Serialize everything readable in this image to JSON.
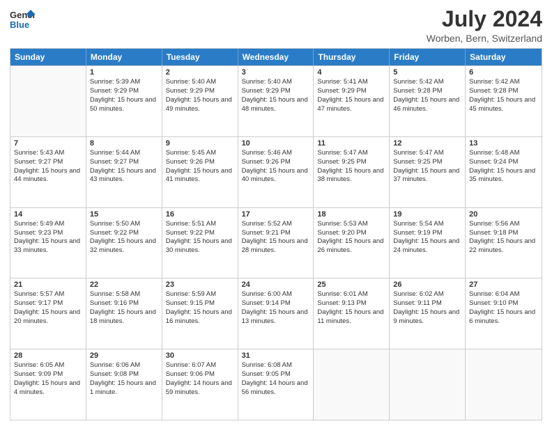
{
  "logo": {
    "text_general": "General",
    "text_blue": "Blue"
  },
  "title": "July 2024",
  "subtitle": "Worben, Bern, Switzerland",
  "days": [
    "Sunday",
    "Monday",
    "Tuesday",
    "Wednesday",
    "Thursday",
    "Friday",
    "Saturday"
  ],
  "weeks": [
    [
      {
        "day": "",
        "empty": true
      },
      {
        "day": "1",
        "rise": "5:39 AM",
        "set": "9:29 PM",
        "daylight": "15 hours and 50 minutes."
      },
      {
        "day": "2",
        "rise": "5:40 AM",
        "set": "9:29 PM",
        "daylight": "15 hours and 49 minutes."
      },
      {
        "day": "3",
        "rise": "5:40 AM",
        "set": "9:29 PM",
        "daylight": "15 hours and 48 minutes."
      },
      {
        "day": "4",
        "rise": "5:41 AM",
        "set": "9:29 PM",
        "daylight": "15 hours and 47 minutes."
      },
      {
        "day": "5",
        "rise": "5:42 AM",
        "set": "9:28 PM",
        "daylight": "15 hours and 46 minutes."
      },
      {
        "day": "6",
        "rise": "5:42 AM",
        "set": "9:28 PM",
        "daylight": "15 hours and 45 minutes."
      }
    ],
    [
      {
        "day": "7",
        "rise": "5:43 AM",
        "set": "9:27 PM",
        "daylight": "15 hours and 44 minutes."
      },
      {
        "day": "8",
        "rise": "5:44 AM",
        "set": "9:27 PM",
        "daylight": "15 hours and 43 minutes."
      },
      {
        "day": "9",
        "rise": "5:45 AM",
        "set": "9:26 PM",
        "daylight": "15 hours and 41 minutes."
      },
      {
        "day": "10",
        "rise": "5:46 AM",
        "set": "9:26 PM",
        "daylight": "15 hours and 40 minutes."
      },
      {
        "day": "11",
        "rise": "5:47 AM",
        "set": "9:25 PM",
        "daylight": "15 hours and 38 minutes."
      },
      {
        "day": "12",
        "rise": "5:47 AM",
        "set": "9:25 PM",
        "daylight": "15 hours and 37 minutes."
      },
      {
        "day": "13",
        "rise": "5:48 AM",
        "set": "9:24 PM",
        "daylight": "15 hours and 35 minutes."
      }
    ],
    [
      {
        "day": "14",
        "rise": "5:49 AM",
        "set": "9:23 PM",
        "daylight": "15 hours and 33 minutes."
      },
      {
        "day": "15",
        "rise": "5:50 AM",
        "set": "9:22 PM",
        "daylight": "15 hours and 32 minutes."
      },
      {
        "day": "16",
        "rise": "5:51 AM",
        "set": "9:22 PM",
        "daylight": "15 hours and 30 minutes."
      },
      {
        "day": "17",
        "rise": "5:52 AM",
        "set": "9:21 PM",
        "daylight": "15 hours and 28 minutes."
      },
      {
        "day": "18",
        "rise": "5:53 AM",
        "set": "9:20 PM",
        "daylight": "15 hours and 26 minutes."
      },
      {
        "day": "19",
        "rise": "5:54 AM",
        "set": "9:19 PM",
        "daylight": "15 hours and 24 minutes."
      },
      {
        "day": "20",
        "rise": "5:56 AM",
        "set": "9:18 PM",
        "daylight": "15 hours and 22 minutes."
      }
    ],
    [
      {
        "day": "21",
        "rise": "5:57 AM",
        "set": "9:17 PM",
        "daylight": "15 hours and 20 minutes."
      },
      {
        "day": "22",
        "rise": "5:58 AM",
        "set": "9:16 PM",
        "daylight": "15 hours and 18 minutes."
      },
      {
        "day": "23",
        "rise": "5:59 AM",
        "set": "9:15 PM",
        "daylight": "15 hours and 16 minutes."
      },
      {
        "day": "24",
        "rise": "6:00 AM",
        "set": "9:14 PM",
        "daylight": "15 hours and 13 minutes."
      },
      {
        "day": "25",
        "rise": "6:01 AM",
        "set": "9:13 PM",
        "daylight": "15 hours and 11 minutes."
      },
      {
        "day": "26",
        "rise": "6:02 AM",
        "set": "9:11 PM",
        "daylight": "15 hours and 9 minutes."
      },
      {
        "day": "27",
        "rise": "6:04 AM",
        "set": "9:10 PM",
        "daylight": "15 hours and 6 minutes."
      }
    ],
    [
      {
        "day": "28",
        "rise": "6:05 AM",
        "set": "9:09 PM",
        "daylight": "15 hours and 4 minutes."
      },
      {
        "day": "29",
        "rise": "6:06 AM",
        "set": "9:08 PM",
        "daylight": "15 hours and 1 minute."
      },
      {
        "day": "30",
        "rise": "6:07 AM",
        "set": "9:06 PM",
        "daylight": "14 hours and 59 minutes."
      },
      {
        "day": "31",
        "rise": "6:08 AM",
        "set": "9:05 PM",
        "daylight": "14 hours and 56 minutes."
      },
      {
        "day": "",
        "empty": true
      },
      {
        "day": "",
        "empty": true
      },
      {
        "day": "",
        "empty": true
      }
    ]
  ]
}
